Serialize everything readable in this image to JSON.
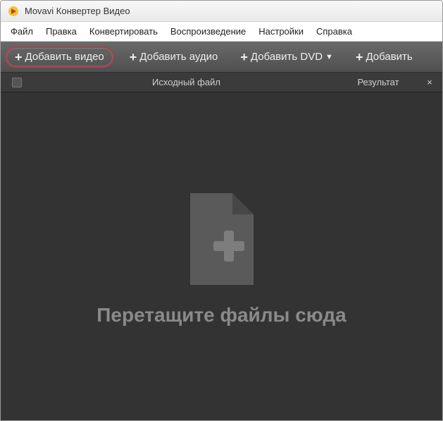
{
  "window": {
    "title": "Movavi Конвертер Видео"
  },
  "menu": {
    "file": "Файл",
    "edit": "Правка",
    "convert": "Конвертировать",
    "play": "Воспроизведение",
    "settings": "Настройки",
    "help": "Справка"
  },
  "toolbar": {
    "add_video": "Добавить видео",
    "add_audio": "Добавить аудио",
    "add_dvd": "Добавить DVD",
    "add_more": "Добавить"
  },
  "columns": {
    "source": "Исходный файл",
    "result": "Результат",
    "close": "×"
  },
  "drop": {
    "text": "Перетащите файлы сюда"
  }
}
